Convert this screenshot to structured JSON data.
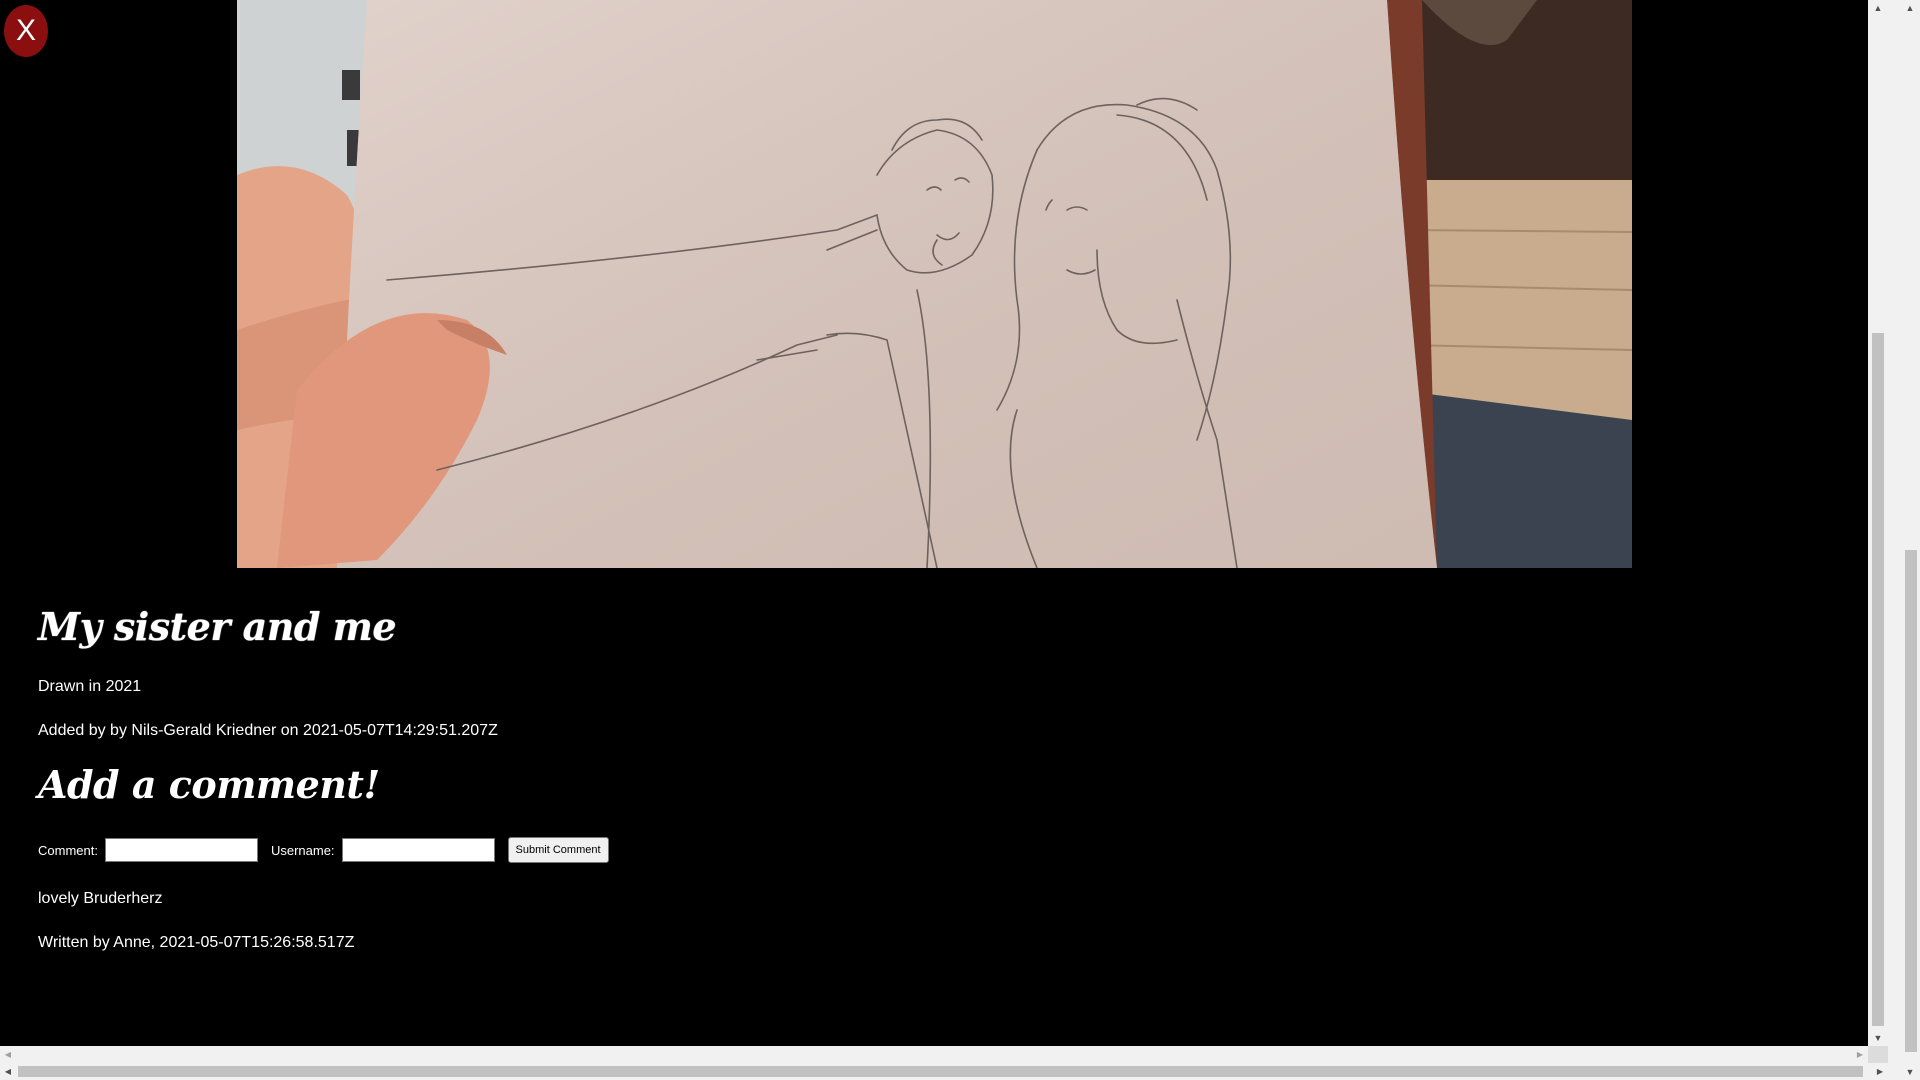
{
  "close": {
    "label": "X"
  },
  "photo": {
    "alt": "pencil drawing of two people held in a hand"
  },
  "artwork": {
    "title": "My sister and me",
    "description": "Drawn in 2021",
    "added": "Added by by Nils-Gerald Kriedner on 2021-05-07T14:29:51.207Z"
  },
  "comment_form": {
    "heading": "Add a comment!",
    "comment_label": "Comment:",
    "comment_value": "",
    "username_label": "Username:",
    "username_value": "",
    "submit_label": "Submit Comment"
  },
  "comments": [
    {
      "text": "lovely Bruderherz",
      "meta": "Written by Anne, 2021-05-07T15:26:58.517Z"
    }
  ],
  "colors": {
    "background": "#000000",
    "close_button": "#8b0f0f",
    "text": "#ffffff"
  },
  "icons": {
    "close": "close-icon",
    "scroll_up": "arrow-up-icon",
    "scroll_down": "arrow-down-icon",
    "scroll_left": "arrow-left-icon",
    "scroll_right": "arrow-right-icon"
  }
}
